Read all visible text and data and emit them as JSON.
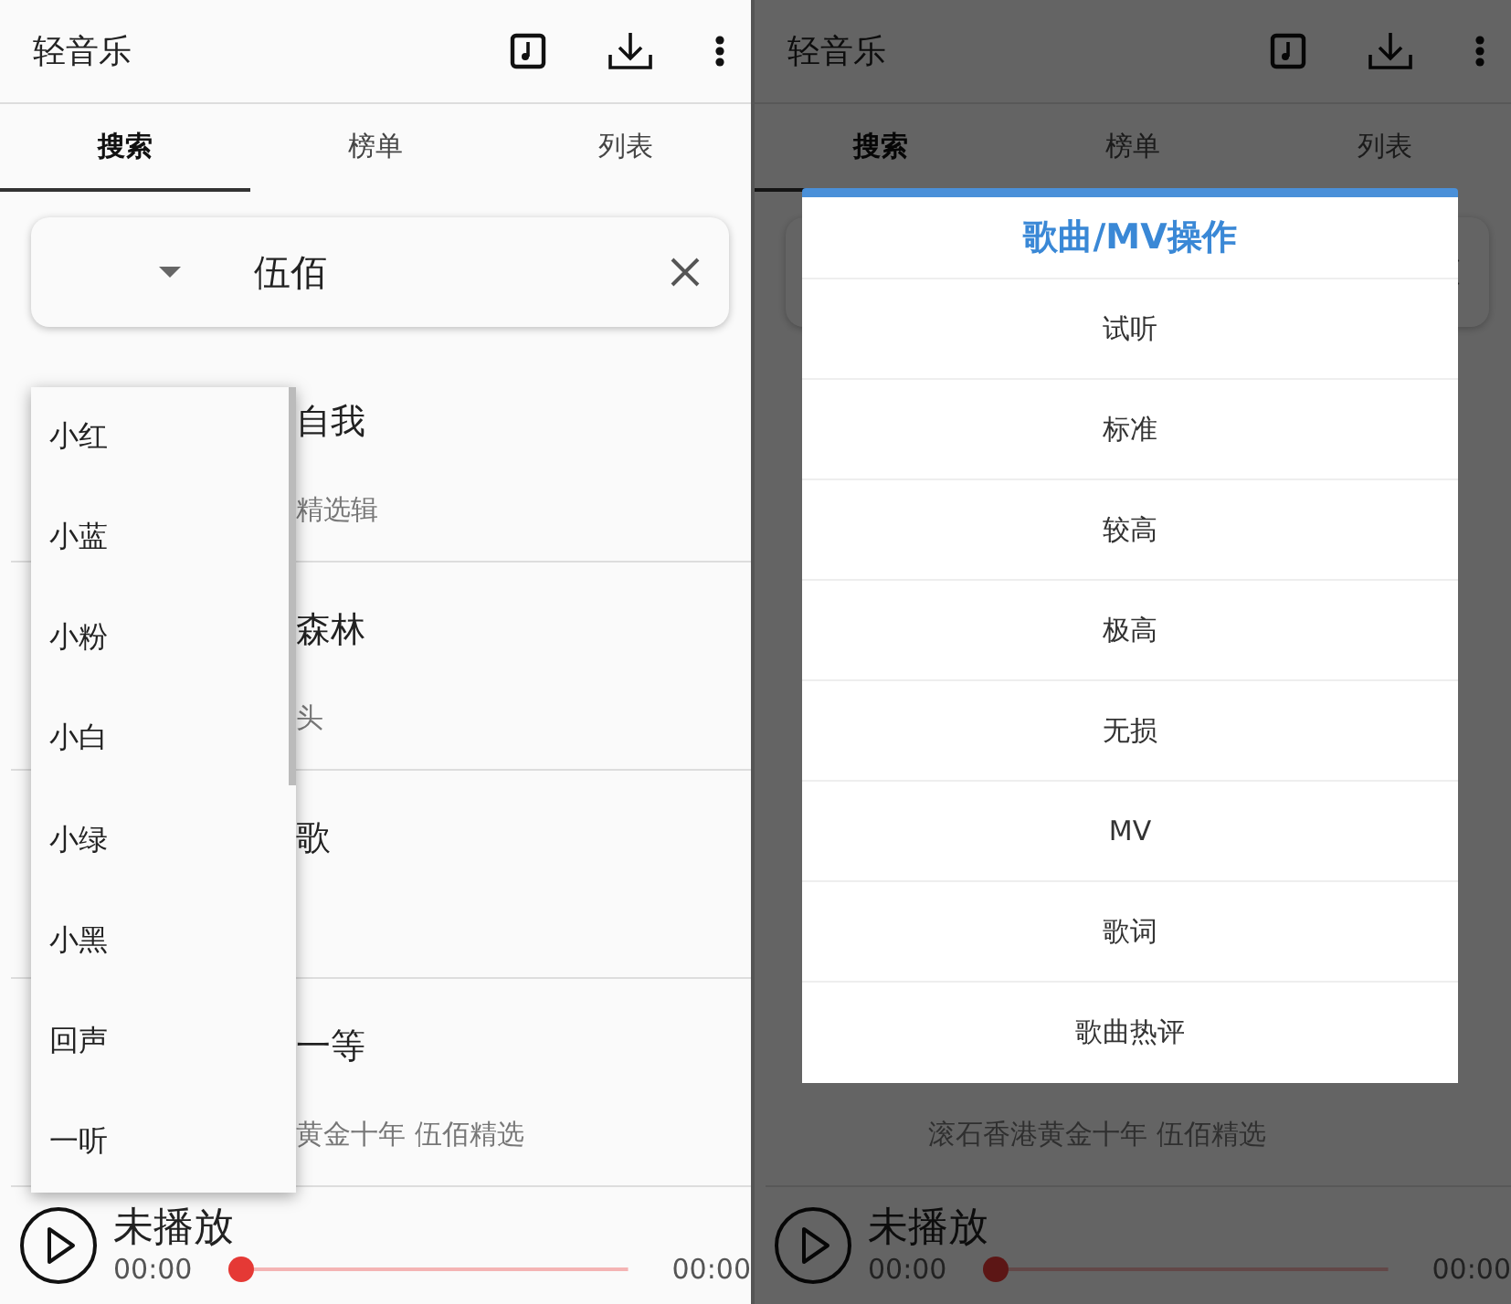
{
  "screens": [
    {
      "app_bar": {
        "title": "轻音乐"
      },
      "tabs": [
        {
          "label": "搜索",
          "selected": true
        },
        {
          "label": "榜单",
          "selected": false
        },
        {
          "label": "列表",
          "selected": false
        }
      ],
      "search": {
        "value": "伍佰"
      },
      "results": [
        {
          "title": "自我",
          "subtitle": "精选辑"
        },
        {
          "title": "森林",
          "subtitle": "头"
        },
        {
          "title": "歌"
        },
        {
          "title": "一等",
          "subtitle": "黄金十年 伍佰精选"
        }
      ],
      "source_menu": {
        "items": [
          "小红",
          "小蓝",
          "小粉",
          "小白",
          "小绿",
          "小黑",
          "回声",
          "一听"
        ]
      },
      "player": {
        "status": "未播放",
        "elapsed": "00:00",
        "duration": "00:00",
        "level": 0
      }
    },
    {
      "app_bar": {
        "title": "轻音乐"
      },
      "tabs": [
        {
          "label": "搜索",
          "selected": true
        },
        {
          "label": "榜单",
          "selected": false
        },
        {
          "label": "列表",
          "selected": false
        }
      ],
      "results": [
        {
          "subtitle": "滚石香港黄金十年 伍佰精选"
        }
      ],
      "dialog": {
        "title": "歌曲/MV操作",
        "items": [
          "试听",
          "标准",
          "较高",
          "极高",
          "无损",
          "MV",
          "歌词",
          "歌曲热评"
        ]
      },
      "player": {
        "status": "未播放",
        "elapsed": "00:00",
        "duration": "00:00",
        "level": 0
      }
    }
  ]
}
